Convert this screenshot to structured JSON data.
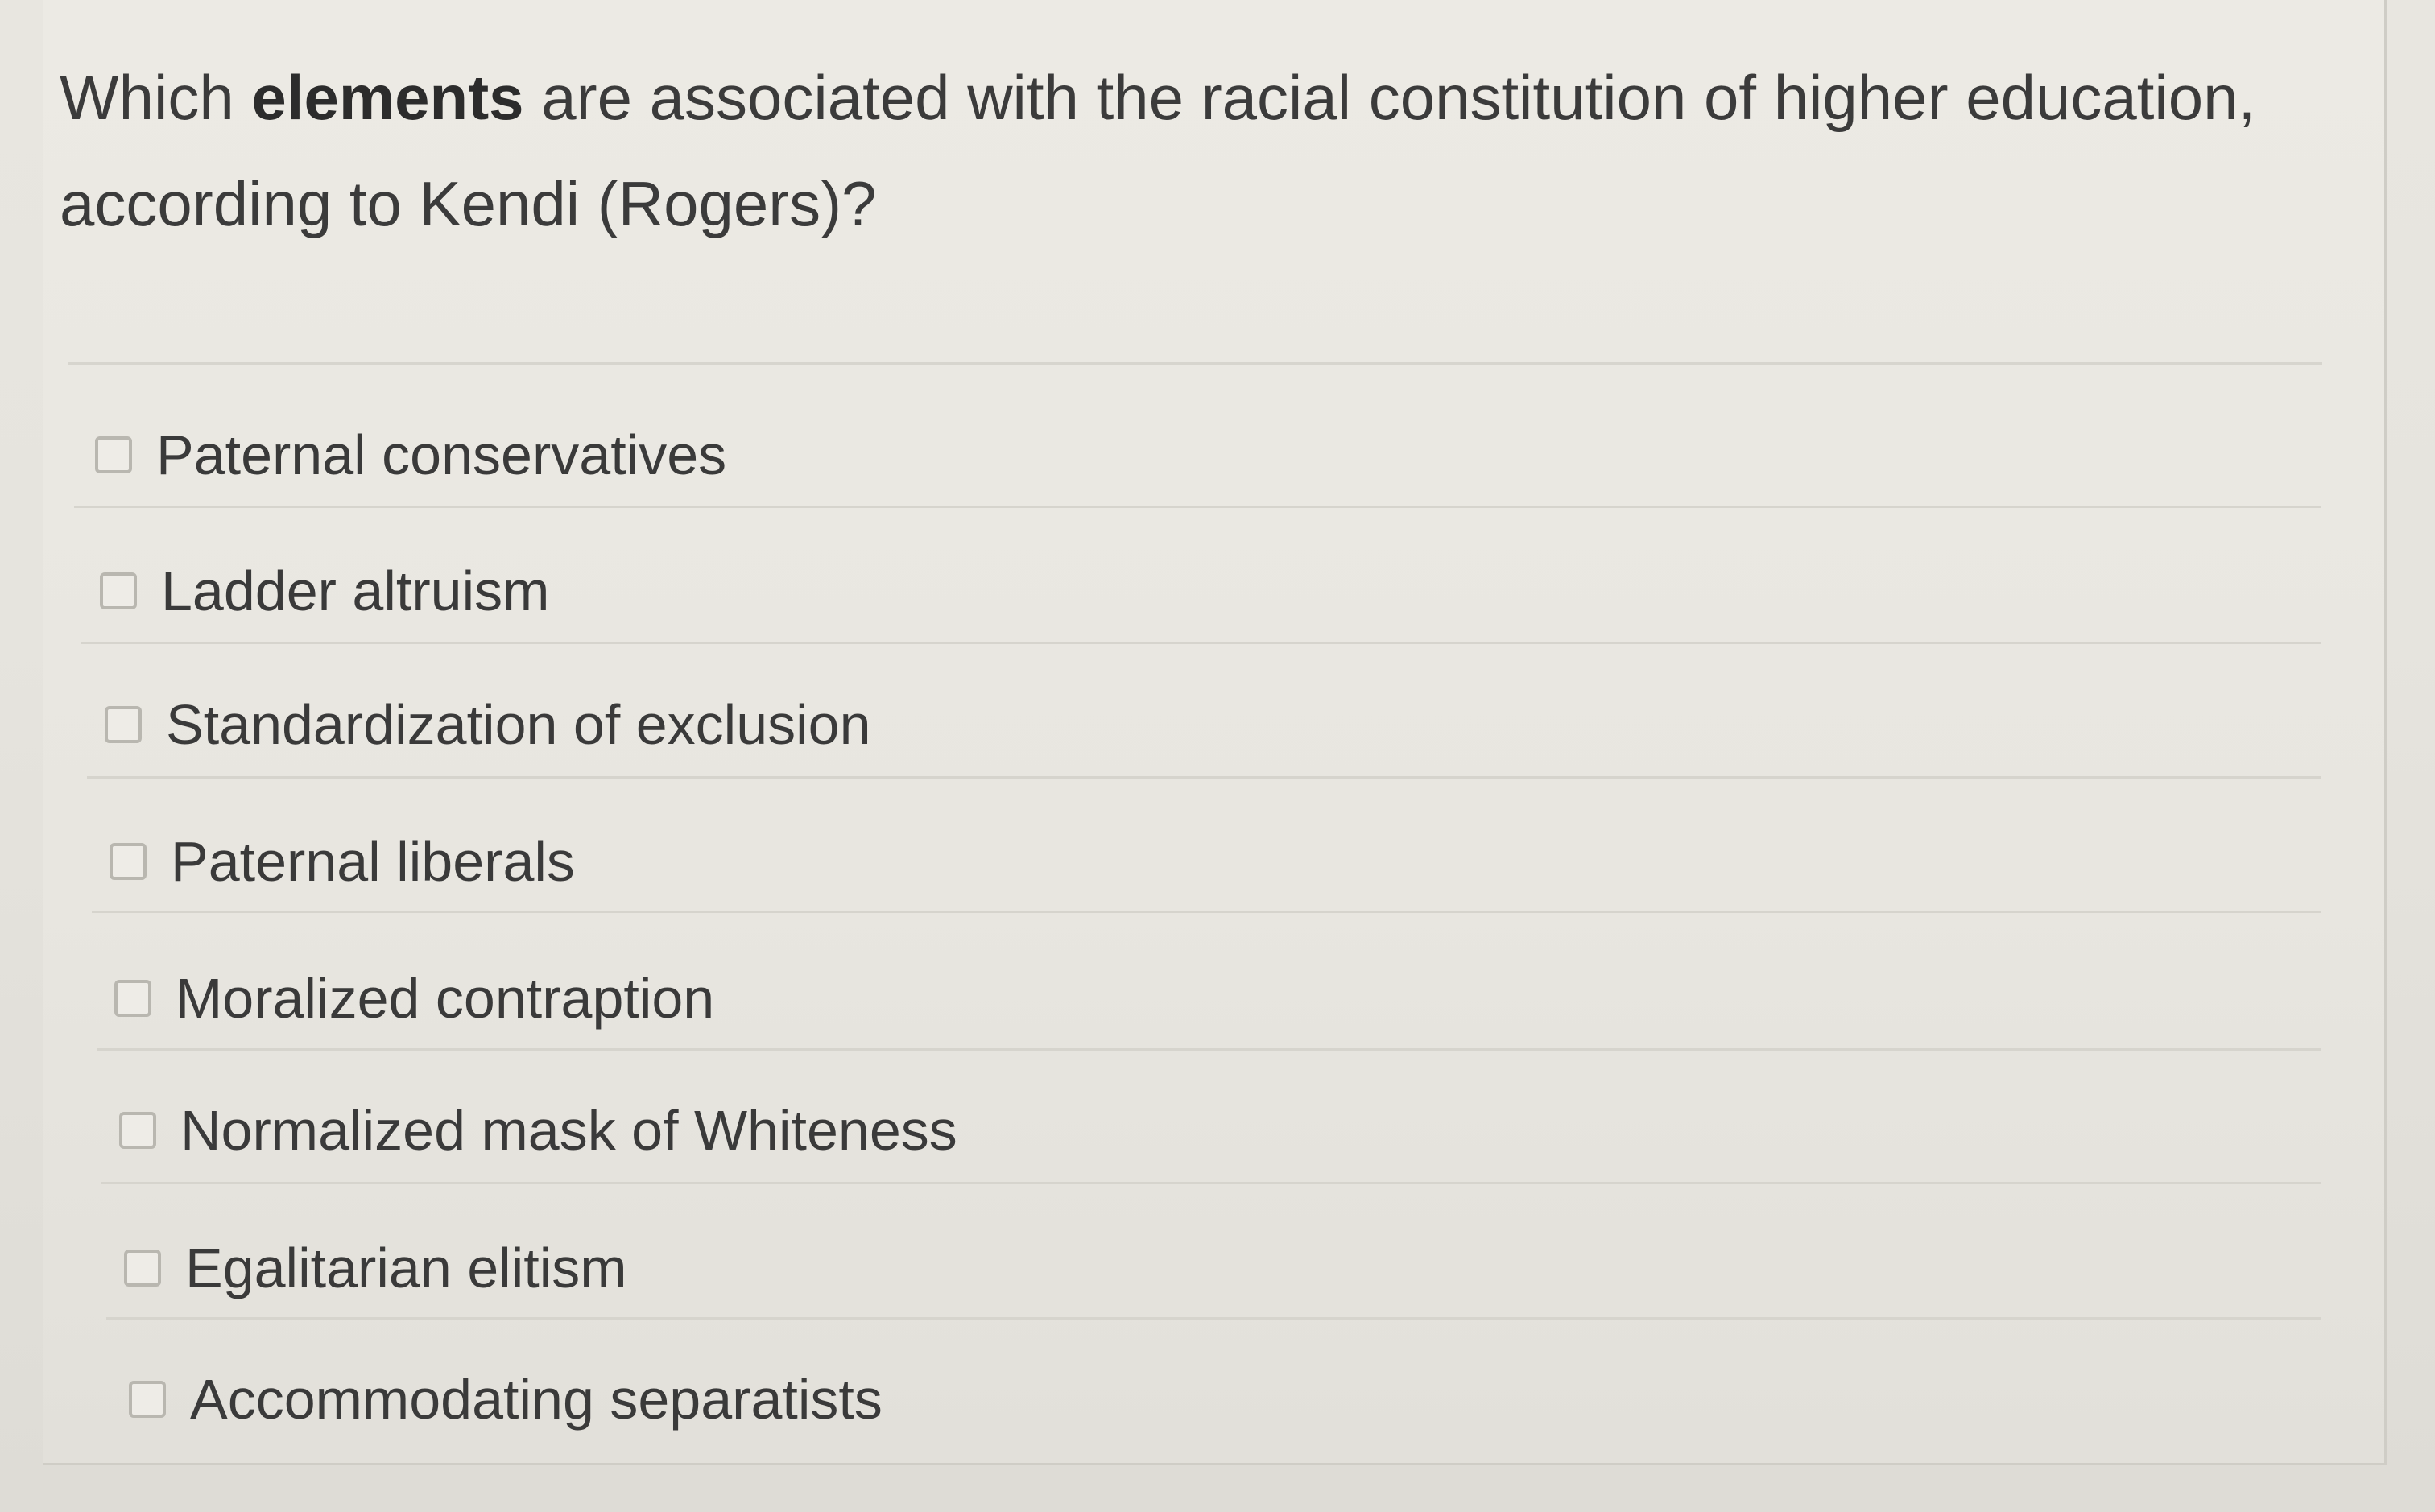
{
  "question": {
    "prefix": "Which ",
    "emphasis": "elements",
    "suffix": " are associated with the racial constitution of higher education,",
    "line2": "according to Kendi (Rogers)?"
  },
  "options": [
    "Paternal conservatives",
    "Ladder altruism",
    "Standardization of exclusion",
    "Paternal liberals",
    "Moralized contraption",
    "Normalized mask of Whiteness",
    "Egalitarian elitism",
    "Accommodating separatists"
  ]
}
